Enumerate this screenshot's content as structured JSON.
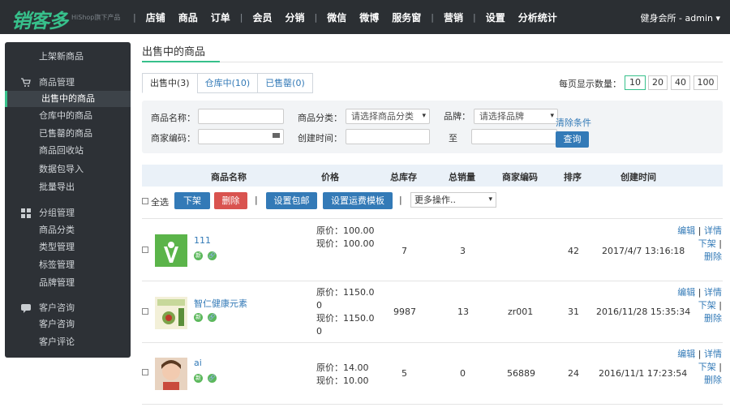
{
  "brand": {
    "logo": "销客多",
    "sub": "HiShop旗下产品"
  },
  "nav": [
    "店铺",
    "商品",
    "订单",
    "会员",
    "分销",
    "微信",
    "微博",
    "服务窗",
    "营销",
    "设置",
    "分析统计"
  ],
  "user": "健身会所 - admin ▾",
  "sidebar": {
    "top_link": "上架新商品",
    "groups": [
      {
        "title": "商品管理",
        "icon": "cart-icon",
        "items": [
          "出售中的商品",
          "仓库中的商品",
          "已售罄的商品",
          "商品回收站",
          "数据包导入",
          "批量导出"
        ]
      },
      {
        "title": "分组管理",
        "icon": "grid-icon",
        "items": [
          "商品分类",
          "类型管理",
          "标签管理",
          "品牌管理"
        ]
      },
      {
        "title": "客户咨询",
        "icon": "chat-icon",
        "items": [
          "客户咨询",
          "客户评论"
        ]
      }
    ]
  },
  "page_title": "出售中的商品",
  "tabs": [
    "出售中(3)",
    "仓库中(10)",
    "已售罄(0)"
  ],
  "pager": {
    "label": "每页显示数量：",
    "options": [
      "10",
      "20",
      "40",
      "100"
    ],
    "selected": "10"
  },
  "filter": {
    "name_label": "商品名称：",
    "category_label": "商品分类：",
    "category_placeholder": "请选择商品分类",
    "brand_label": "品牌：",
    "brand_placeholder": "请选择品牌",
    "clear": "清除条件",
    "code_label": "商家编码：",
    "created_label": "创建时间：",
    "to_label": "至",
    "query": "查询"
  },
  "table": {
    "headers": [
      "商品名称",
      "价格",
      "总库存",
      "总销量",
      "商家编码",
      "排序",
      "创建时间"
    ],
    "select_all": "全选",
    "actions": {
      "off": "下架",
      "delete": "删除",
      "freeship": "设置包邮",
      "template": "设置运费模板",
      "more": "更多操作.."
    },
    "rows": [
      {
        "name": "111",
        "orig_price": "原价：100.00",
        "cur_price": "现价：100.00",
        "stock": "7",
        "sales": "3",
        "code": "",
        "sort": "42",
        "created": "2017/4/7 13:16:18",
        "thumb": "green-logo"
      },
      {
        "name": "智仁健康元素",
        "orig_price": "原价：1150.00",
        "cur_price": "现价：1150.00",
        "stock": "9987",
        "sales": "13",
        "code": "zr001",
        "sort": "31",
        "created": "2016/11/28 15:35:34",
        "thumb": "book-cover"
      },
      {
        "name": "ai",
        "orig_price": "原价：14.00",
        "cur_price": "现价：10.00",
        "stock": "5",
        "sales": "0",
        "code": "56889",
        "sort": "24",
        "created": "2016/11/1 17:23:54",
        "thumb": "baby-photo"
      }
    ],
    "ops": {
      "edit": "编辑",
      "detail": "详情",
      "off": "下架",
      "delete": "删除"
    },
    "badges": {
      "new": "新",
      "link": "🔗"
    }
  },
  "colors": {
    "accent": "#37c08b",
    "primary": "#337ab7",
    "danger": "#d9534f",
    "topbar": "#2b2f33"
  }
}
